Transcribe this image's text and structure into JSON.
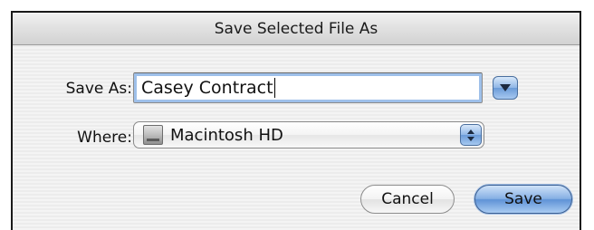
{
  "dialog": {
    "title": "Save Selected File As"
  },
  "form": {
    "save_as_label": "Save As:",
    "save_as_value": "Casey Contract",
    "where_label": "Where:",
    "where_value": "Macintosh HD"
  },
  "icons": {
    "expand": "disclosure-triangle-icon",
    "volume": "hard-drive-icon",
    "stepper": "up-down-arrows-icon"
  },
  "buttons": {
    "cancel_label": "Cancel",
    "save_label": "Save"
  },
  "colors": {
    "focus_ring": "#9ec0ea",
    "default_button": "#6b9bd8"
  }
}
